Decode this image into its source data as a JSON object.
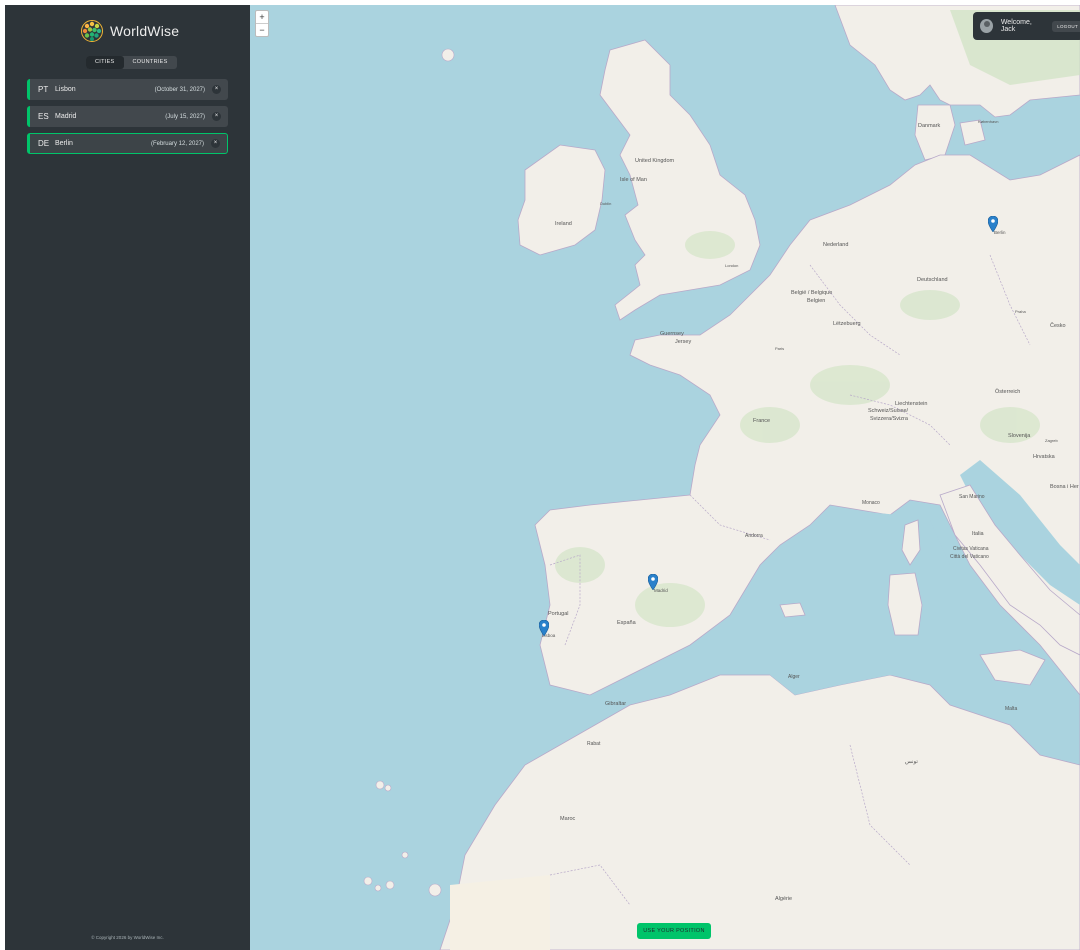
{
  "app": {
    "brand": "WorldWise"
  },
  "nav": {
    "cities_label": "CITIES",
    "countries_label": "COUNTRIES",
    "active": "cities"
  },
  "cities": [
    {
      "code": "PT",
      "name": "Lisbon",
      "date": "(October 31, 2027)",
      "delete_label": "×",
      "selected": false
    },
    {
      "code": "ES",
      "name": "Madrid",
      "date": "(July 15, 2027)",
      "delete_label": "×",
      "selected": false
    },
    {
      "code": "DE",
      "name": "Berlin",
      "date": "(February 12, 2027)",
      "delete_label": "×",
      "selected": true
    }
  ],
  "footer": {
    "copyright": "© Copyright 2026 by WorldWise Inc."
  },
  "user": {
    "welcome": "Welcome, Jack",
    "logout_label": "LOGOUT"
  },
  "map": {
    "zoom_in": "+",
    "zoom_out": "−",
    "use_position_label": "USE YOUR POSITION",
    "markers": [
      {
        "city": "Lisbon",
        "label": "Lisboa"
      },
      {
        "city": "Madrid",
        "label": "Madrid"
      },
      {
        "city": "Berlin",
        "label": "Berlin"
      }
    ],
    "labels": {
      "united_kingdom": "United Kingdom",
      "isle_of_man": "Isle of Man",
      "ireland": "Ireland",
      "dublin": "Dublin",
      "london": "London",
      "danmark": "Danmark",
      "kobenhavn": "København",
      "nederland": "Nederland",
      "deutschland": "Deutschland",
      "belgie": "België / Belgique",
      "belgien": "Belgien",
      "luxembourg": "Lëtzebuerg",
      "guernsey": "Guernsey",
      "jersey": "Jersey",
      "paris": "Paris",
      "france": "France",
      "liechtenstein": "Liechtenstein",
      "schweiz": "Schweiz/Suisse/",
      "svizzera": "Svizzera/Svizra",
      "osterreich": "Österreich",
      "cesko": "Česko",
      "praha": "Praha",
      "slovenija": "Slovenija",
      "zagreb": "Zagreb",
      "hrvatska": "Hrvatska",
      "bosna": "Bosna i Her",
      "monaco": "Monaco",
      "san_marino": "San Marino",
      "andorra": "Andorra",
      "italia": "Italia",
      "vaticano1": "Civitas Vaticana",
      "vaticano2": "Città del Vaticano",
      "portugal": "Portugal",
      "espana": "España",
      "gibraltar": "Gibraltar",
      "alger": "Alger",
      "malta": "Malta",
      "rabat": "Rabat",
      "maroc": "Maroc",
      "algerie": "Algérie",
      "tunis": "تونس"
    }
  }
}
